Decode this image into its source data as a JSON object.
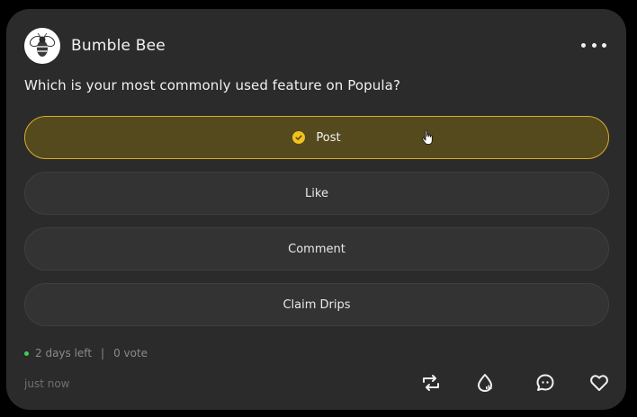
{
  "post": {
    "author": "Bumble Bee",
    "question": "Which is your most commonly used feature on Popula?",
    "options": [
      {
        "label": "Post",
        "selected": true
      },
      {
        "label": "Like",
        "selected": false
      },
      {
        "label": "Comment",
        "selected": false
      },
      {
        "label": "Claim Drips",
        "selected": false
      }
    ],
    "time_left": "2 days left",
    "separator": "|",
    "votes": "0 vote",
    "posted": "just now"
  },
  "icons": {
    "more": "more-horizontal-icon",
    "check": "check-circle-icon",
    "repost": "repost-icon",
    "drip": "drip-icon",
    "comment": "comment-bubble-icon",
    "like": "heart-icon"
  },
  "colors": {
    "card_bg": "#2b2b2b",
    "option_bg": "#333333",
    "selected_bg": "#55491e",
    "selected_border": "#d6ad2a",
    "accent_yellow": "#f2c21b",
    "status_green": "#3ccf55"
  }
}
